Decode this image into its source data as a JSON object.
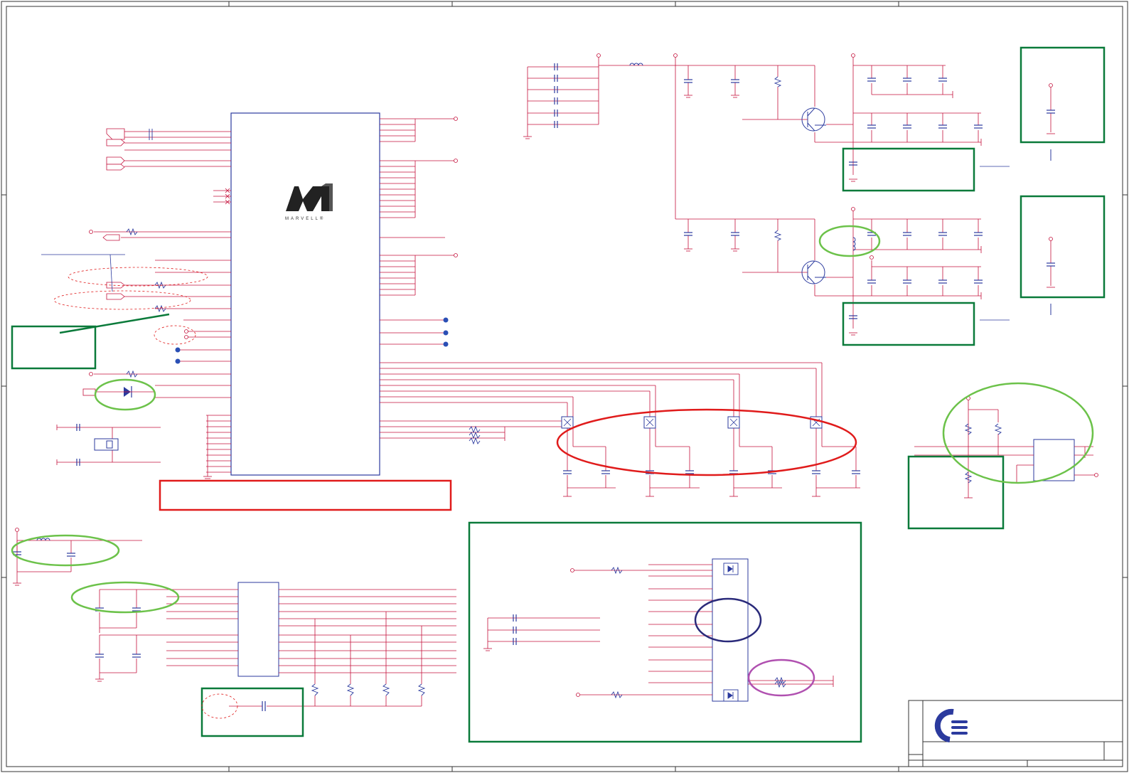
{
  "logo": {
    "chip_vendor_text": "MARVELL®",
    "chip_vendor_icon": "marvell-logo-icon",
    "company_icon": "company-logo-icon"
  },
  "colors": {
    "wire": "#c4123c",
    "component": "#2b3a9e",
    "border": "#333333",
    "note_box": "#0a7a3a",
    "red_highlight": "#e01b1b",
    "green_highlight": "#6cc24a",
    "navy_highlight": "#2a2a7a",
    "purple_highlight": "#b050b0",
    "junction": "#2a4fb5"
  },
  "frame": {
    "column_markers": 5,
    "row_markers": 4
  }
}
